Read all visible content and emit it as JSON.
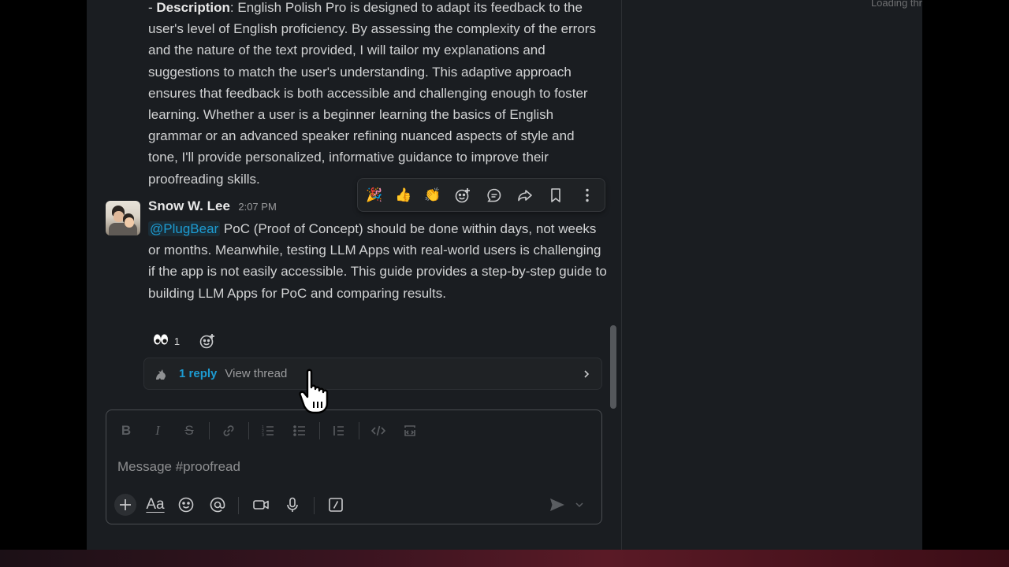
{
  "thread_pane": {
    "loading_text": "Loading thr"
  },
  "previous_message": {
    "prefix": "- ",
    "label": "Description",
    "text": ": English Polish Pro is designed to adapt its feedback to the user's level of English proficiency. By assessing the complexity of the errors and the nature of the text provided, I will tailor my explanations and suggestions to match the user's understanding. This adaptive approach ensures that feedback is both accessible and challenging enough to foster learning. Whether a user is a beginner learning the basics of English grammar or an advanced speaker refining nuanced aspects of style and tone, I'll provide personalized, informative guidance to improve their proofreading skills."
  },
  "message": {
    "author": "Snow W. Lee",
    "time": "2:07 PM",
    "mention": "@PlugBear",
    "body": " PoC (Proof of Concept) should be done within days, not weeks or months. Meanwhile, testing LLM Apps with real-world users is challenging if the app is not easily accessible. This guide provides a step-by-step guide to building LLM Apps for PoC and comparing results.",
    "reactions": [
      {
        "emoji": "👀",
        "count": "1"
      }
    ],
    "thread": {
      "reply_count": "1 reply",
      "view_label": "View thread"
    }
  },
  "hover_toolbar": {
    "items": [
      {
        "icon": "party-popper-icon",
        "glyph": "🎉"
      },
      {
        "icon": "thumbs-up-icon",
        "glyph": "👍"
      },
      {
        "icon": "clapping-hands-icon",
        "glyph": "👏"
      },
      {
        "icon": "add-reaction-icon"
      },
      {
        "icon": "reply-in-thread-icon"
      },
      {
        "icon": "forward-icon"
      },
      {
        "icon": "bookmark-icon"
      },
      {
        "icon": "more-actions-icon"
      }
    ]
  },
  "composer": {
    "placeholder": "Message #proofread",
    "format_label": "Aa"
  },
  "colors": {
    "background": "#1a1d21",
    "link": "#1d9bd1",
    "text": "#d1d2d3"
  }
}
